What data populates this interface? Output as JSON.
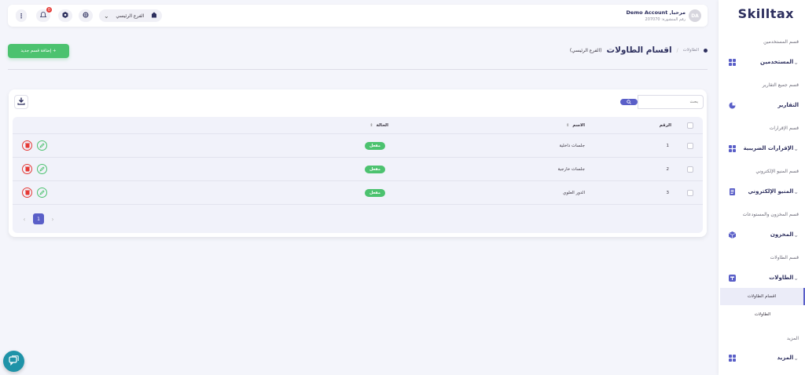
{
  "sidebar": {
    "logo": "Skilltax",
    "sections": [
      {
        "title": "قسم المستخدمين",
        "item": "المستخدمين",
        "icon": "grid-icon"
      },
      {
        "title": "قسم جميع التقارير",
        "item": "التقارير",
        "icon": "pie-chart-icon"
      },
      {
        "title": "قسم الإقرارات",
        "item": "الإقرارات الضريبية",
        "icon": "grid-icon"
      },
      {
        "title": "قسم المنيو الإلكتروني",
        "item": "المنيو الإلكتروني",
        "icon": "document-icon"
      },
      {
        "title": "قسم المخزون والمستودعات",
        "item": "المخزون",
        "icon": "box-icon"
      },
      {
        "title": "قسم الطاولات",
        "item": "الطاولات",
        "icon": "table-icon"
      },
      {
        "title": "المزيد",
        "item": "المزيد",
        "icon": "grid-icon"
      }
    ],
    "sub_items": {
      "tables_sections": "اقسام الطاولات",
      "tables": "الطاولات"
    }
  },
  "topbar": {
    "avatar": "DA",
    "greeting": "مرحبا, Demo Account",
    "company": "رقم المنشورة: 207070",
    "branch": "الفرع الرئيسي",
    "notifications": "0"
  },
  "page": {
    "breadcrumb_link": "الطاولات",
    "breadcrumb_sep": "/",
    "title": "اقسام الطاولات",
    "subtitle": "(الفرع الرئيسي)",
    "add_button": "+ إضافة قسم جديد"
  },
  "table": {
    "search_placeholder": "بحث",
    "columns": {
      "number": "الرقم",
      "name": "الاسم",
      "status": "الحالة"
    },
    "rows": [
      {
        "number": "1",
        "name": "جلسات داخلية",
        "status": "مفعل"
      },
      {
        "number": "2",
        "name": "جلسات خارجية",
        "status": "مفعل"
      },
      {
        "number": "3",
        "name": "الدور العلوي",
        "status": "مفعل"
      }
    ],
    "page": "1"
  },
  "colors": {
    "primary": "#5a5fc8",
    "success": "#4cc26f",
    "danger": "#e53935",
    "navy": "#2d2f5e"
  }
}
